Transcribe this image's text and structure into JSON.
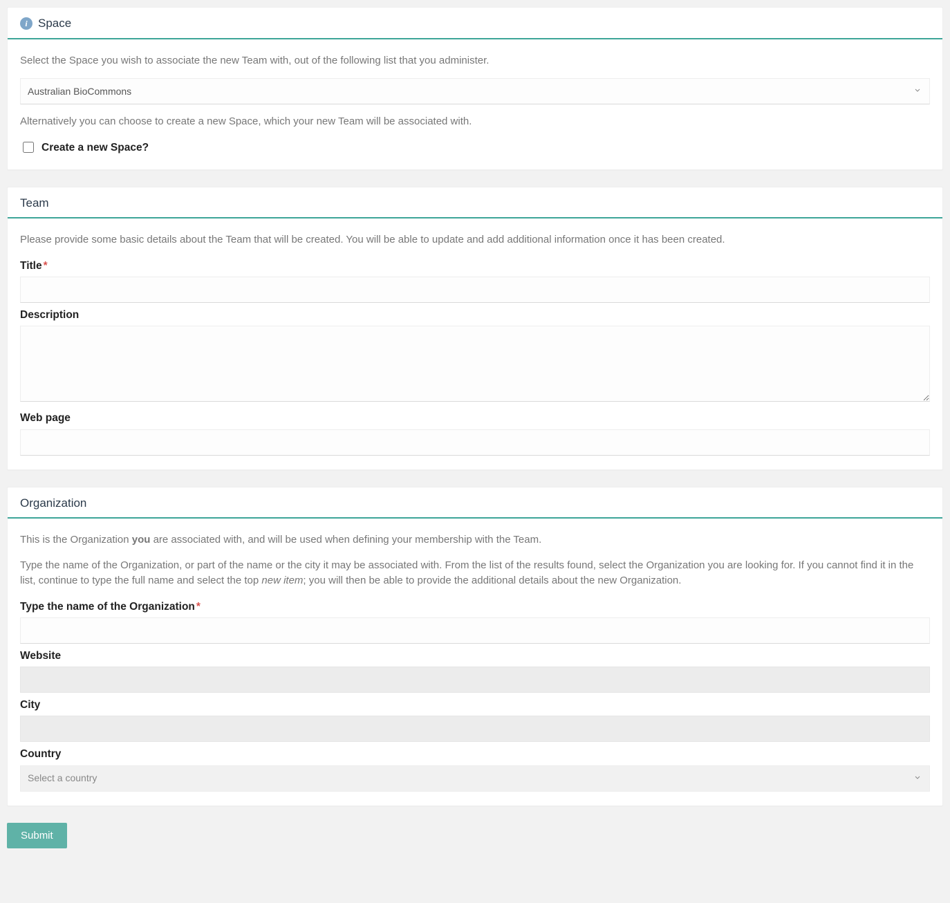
{
  "space": {
    "heading": "Space",
    "intro": "Select the Space you wish to associate the new Team with, out of the following list that you administer.",
    "selected": "Australian BioCommons",
    "alt_hint": "Alternatively you can choose to create a new Space, which your new Team will be associated with.",
    "create_label": "Create a new Space?"
  },
  "team": {
    "heading": "Team",
    "intro": "Please provide some basic details about the Team that will be created. You will be able to update and add additional information once it has been created.",
    "title_label": "Title",
    "desc_label": "Description",
    "web_label": "Web page"
  },
  "org": {
    "heading": "Organization",
    "intro_pre": "This is the Organization ",
    "intro_bold": "you",
    "intro_post": " are associated with, and will be used when defining your membership with the Team.",
    "type_hint_pre": "Type the name of the Organization, or part of the name or the city it may be associated with. From the list of the results found, select the Organization you are looking for. If you cannot find it in the list, continue to type the full name and select the top ",
    "type_hint_italic": "new item",
    "type_hint_post": "; you will then be able to provide the additional details about the new Organization.",
    "name_label": "Type the name of the Organization",
    "website_label": "Website",
    "city_label": "City",
    "country_label": "Country",
    "country_placeholder": "Select a country"
  },
  "actions": {
    "submit": "Submit"
  }
}
